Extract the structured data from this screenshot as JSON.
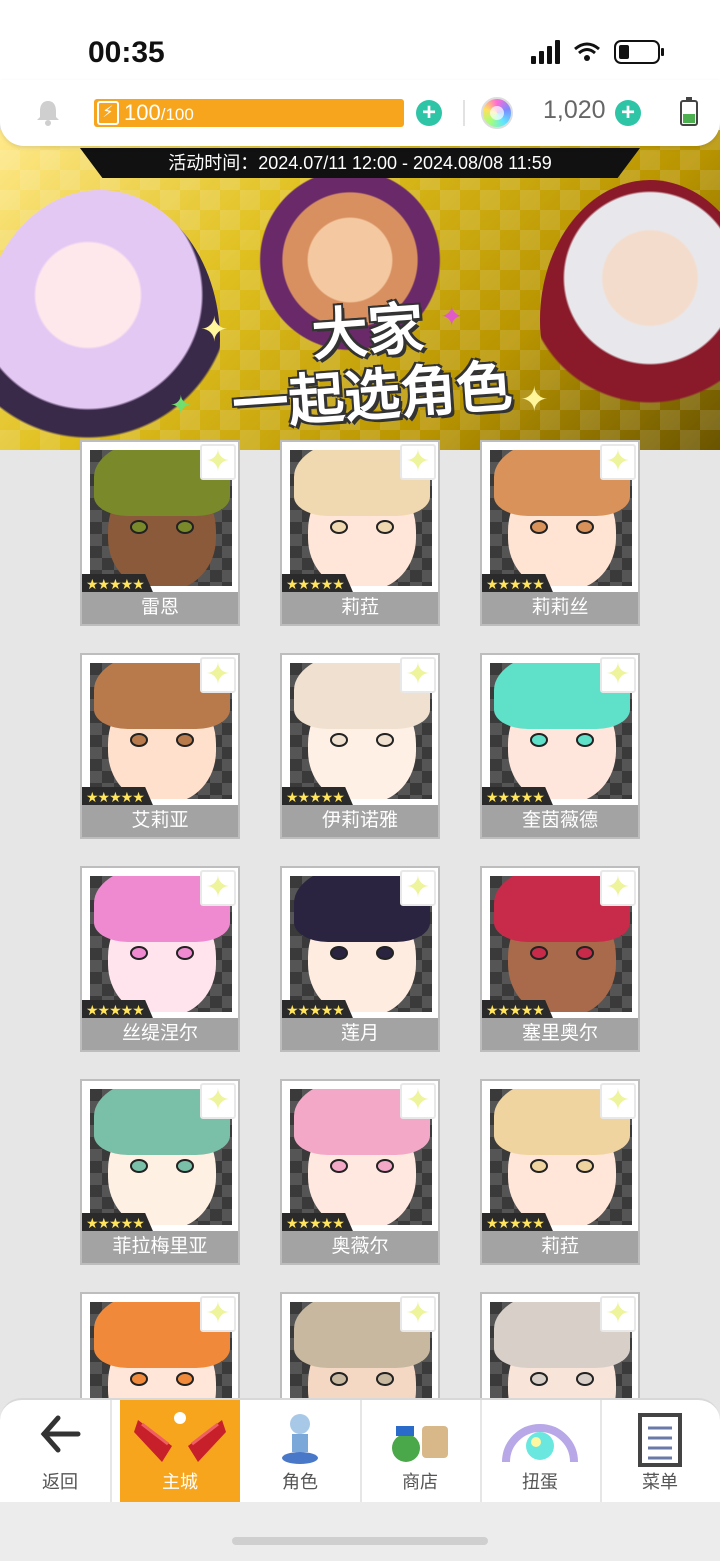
{
  "status_bar": {
    "time": "00:35"
  },
  "resources": {
    "energy_current": "100",
    "energy_max": "/100",
    "energy_icon": "lightning-icon",
    "gems": "1,020"
  },
  "banner": {
    "event_time": "活动时间：2024.07/11 12:00 - 2024.08/08 11:59",
    "title_line1": "大家",
    "title_line2": "一起选角色"
  },
  "characters": [
    {
      "name": "雷恩",
      "stars": "★★★★★",
      "hair": "#7a8a2a",
      "skin": "#8a5a3a"
    },
    {
      "name": "莉菈",
      "stars": "★★★★★",
      "hair": "#f0d8b0",
      "skin": "#ffe6d8"
    },
    {
      "name": "莉莉丝",
      "stars": "★★★★★",
      "hair": "#d8925a",
      "skin": "#ffe4d4"
    },
    {
      "name": "艾莉亚",
      "stars": "★★★★★",
      "hair": "#b87a4a",
      "skin": "#ffe0cc"
    },
    {
      "name": "伊莉诺雅",
      "stars": "★★★★★",
      "hair": "#efe0d0",
      "skin": "#fff0e6"
    },
    {
      "name": "奎茵薇德",
      "stars": "★★★★★",
      "hair": "#5fe0c8",
      "skin": "#ffe6dc"
    },
    {
      "name": "丝缇涅尔",
      "stars": "★★★★★",
      "hair": "#f08ad0",
      "skin": "#ffe4ee"
    },
    {
      "name": "莲月",
      "stars": "★★★★★",
      "hair": "#2a2440",
      "skin": "#ffece0"
    },
    {
      "name": "塞里奥尔",
      "stars": "★★★★★",
      "hair": "#c82a4a",
      "skin": "#a86a4a"
    },
    {
      "name": "菲拉梅里亚",
      "stars": "★★★★★",
      "hair": "#7ac0a8",
      "skin": "#fff0e4"
    },
    {
      "name": "奥薇尔",
      "stars": "★★★★★",
      "hair": "#f4a8c8",
      "skin": "#ffe8e0"
    },
    {
      "name": "莉菈",
      "stars": "★★★★★",
      "hair": "#f0d4a0",
      "skin": "#ffe6d8"
    },
    {
      "name": "",
      "stars": "",
      "hair": "#f08a3a",
      "skin": "#ffe6d8"
    },
    {
      "name": "",
      "stars": "",
      "hair": "#c8b8a0",
      "skin": "#f4d8c4"
    },
    {
      "name": "",
      "stars": "",
      "hair": "#d8d0c8",
      "skin": "#f8e4d8"
    }
  ],
  "nav": {
    "back": "返回",
    "main_city": "主城",
    "characters": "角色",
    "shop": "商店",
    "gacha": "扭蛋",
    "menu": "菜单"
  },
  "colors": {
    "accent": "#f7a51d",
    "plus": "#2ec4a6",
    "card_label": "#a3a3a3"
  }
}
